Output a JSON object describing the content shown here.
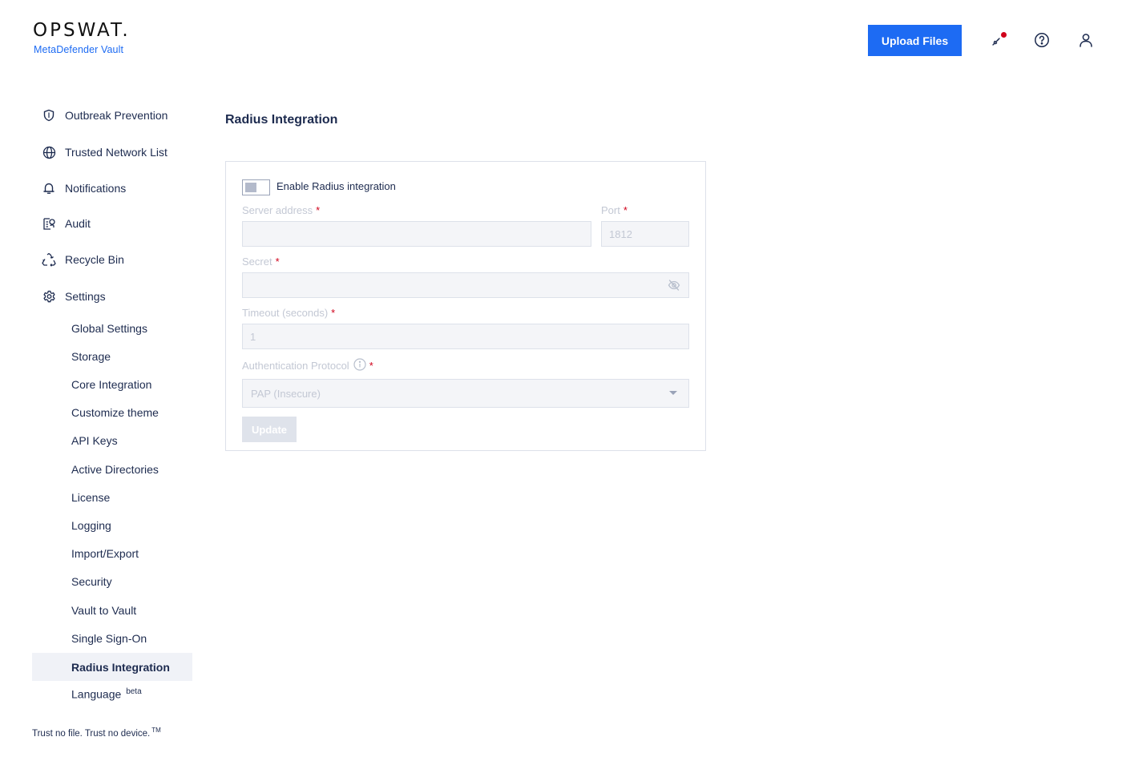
{
  "brand": {
    "logo_text": "OPSWAT.",
    "product": "MetaDefender Vault",
    "tagline": "Trust no file. Trust no device.",
    "tagline_tm": "TM"
  },
  "header": {
    "upload_label": "Upload Files",
    "icons": [
      "notification-icon",
      "help-icon",
      "user-icon"
    ],
    "accent_color": "#1d6bf3",
    "notification_dot_color": "#d0021b"
  },
  "sidebar": {
    "items": [
      {
        "label": "Outbreak Prevention",
        "icon": "shield-icon"
      },
      {
        "label": "Trusted Network List",
        "icon": "globe-icon"
      },
      {
        "label": "Notifications",
        "icon": "bell-icon"
      },
      {
        "label": "Audit",
        "icon": "audit-icon"
      },
      {
        "label": "Recycle Bin",
        "icon": "recycle-icon"
      },
      {
        "label": "Settings",
        "icon": "gear-icon"
      }
    ],
    "settings_items": [
      {
        "label": "Global Settings"
      },
      {
        "label": "Storage"
      },
      {
        "label": "Core Integration"
      },
      {
        "label": "Customize theme"
      },
      {
        "label": "API Keys"
      },
      {
        "label": "Active Directories"
      },
      {
        "label": "License"
      },
      {
        "label": "Logging"
      },
      {
        "label": "Import/Export"
      },
      {
        "label": "Security"
      },
      {
        "label": "Vault to Vault"
      },
      {
        "label": "Single Sign-On"
      },
      {
        "label": "Radius Integration",
        "active": true
      },
      {
        "label": "Language",
        "badge": "beta"
      }
    ]
  },
  "main": {
    "title": "Radius Integration",
    "form": {
      "enable_label": "Enable Radius integration",
      "enabled": false,
      "server_address": {
        "label": "Server address",
        "required": "*",
        "value": ""
      },
      "port": {
        "label": "Port",
        "required": "*",
        "value": "1812"
      },
      "secret": {
        "label": "Secret",
        "required": "*",
        "value": ""
      },
      "timeout": {
        "label": "Timeout (seconds)",
        "required": "*",
        "value": "1"
      },
      "auth_protocol": {
        "label": "Authentication Protocol",
        "required": "*",
        "value": "PAP (Insecure)"
      },
      "update_label": "Update"
    }
  }
}
